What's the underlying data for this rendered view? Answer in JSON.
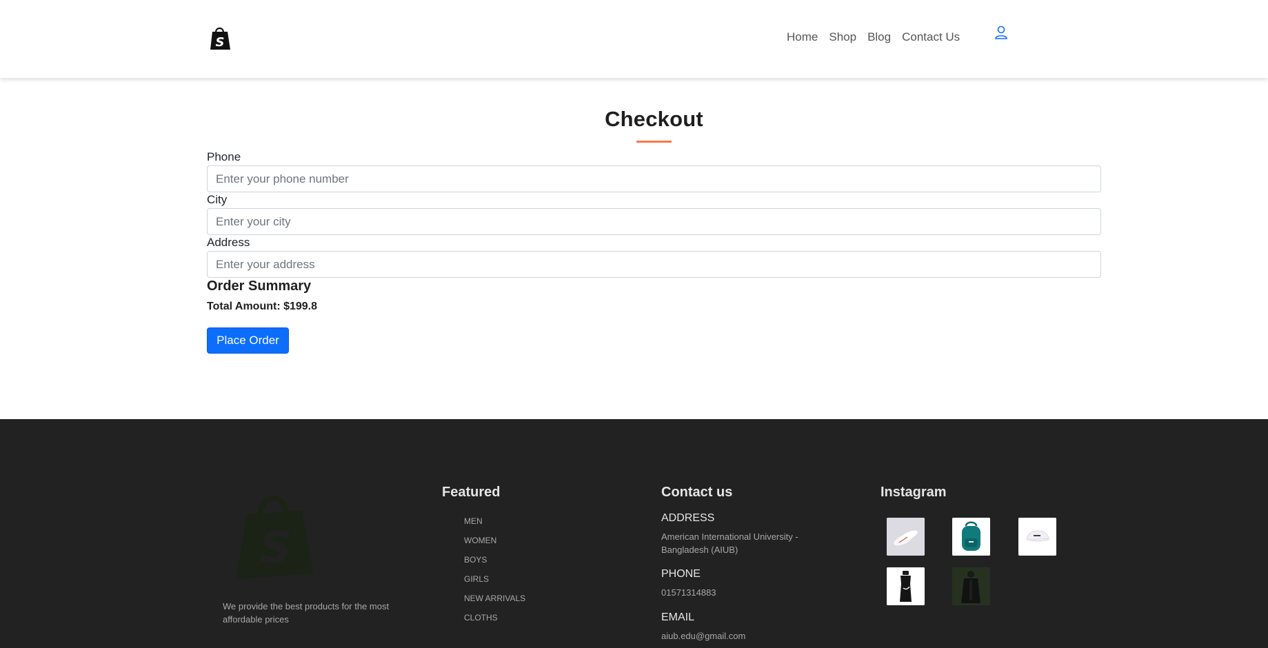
{
  "header": {
    "logo_icon": "shopify-bag-icon",
    "nav": [
      "Home",
      "Shop",
      "Blog",
      "Contact Us"
    ],
    "user_icon": "user-icon"
  },
  "checkout": {
    "title": "Checkout",
    "phone_label": "Phone",
    "phone_placeholder": "Enter your phone number",
    "city_label": "City",
    "city_placeholder": "Enter your city",
    "address_label": "Address",
    "address_placeholder": "Enter your address",
    "summary_title": "Order Summary",
    "total_text": "Total Amount: $199.8",
    "place_order_label": "Place Order"
  },
  "footer": {
    "description": "We provide the best products for the most affordable prices",
    "featured": {
      "title": "Featured",
      "items": [
        "MEN",
        "WOMEN",
        "BOYS",
        "GIRLS",
        "NEW ARRIVALS",
        "CLOTHS"
      ]
    },
    "contact": {
      "title": "Contact us",
      "address_label": "ADDRESS",
      "address": "American International University - Bangladesh (AIUB)",
      "phone_label": "PHONE",
      "phone": "01571314883",
      "email_label": "EMAIL",
      "email": "aiub.edu@gmail.com"
    },
    "instagram": {
      "title": "Instagram",
      "images": [
        "white-sneakers-image",
        "teal-backpack-image",
        "white-cap-image",
        "black-water-bottle-image",
        "black-jacket-image"
      ]
    }
  },
  "colors": {
    "accent": "#fb774b",
    "primary_button": "#0d6efd",
    "footer_bg": "#222222"
  }
}
